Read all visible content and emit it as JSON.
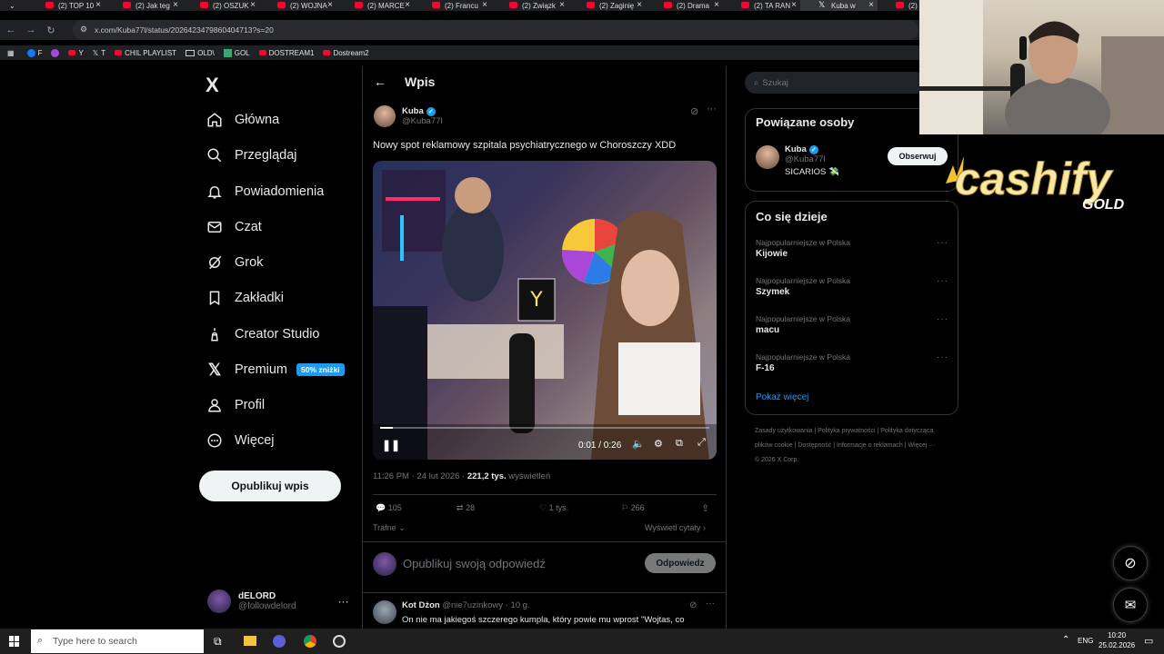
{
  "browser": {
    "tabs": [
      {
        "label": "(2) TOP 10"
      },
      {
        "label": "(2) Jak teg"
      },
      {
        "label": "(2) OSZUK"
      },
      {
        "label": "(2) WOJNA"
      },
      {
        "label": "(2) MARCE"
      },
      {
        "label": "(2) Francu"
      },
      {
        "label": "(2) Związk"
      },
      {
        "label": "(2) Zaginię"
      },
      {
        "label": "(2) Drama"
      },
      {
        "label": "(2) TA RAN"
      },
      {
        "label": "Kuba w"
      },
      {
        "label": "(2) Dl"
      }
    ],
    "url": "x.com/Kuba77l/status/2026423479860404713?s=20",
    "bookmarks": [
      "F",
      "Y",
      "T",
      "CHIL PLAYLIST",
      "OLD\\",
      "GOL",
      "DOSTREAM1",
      "Dostream2"
    ]
  },
  "sidebar": {
    "logo": "X",
    "items": [
      {
        "label": "Główna",
        "icon": "home-icon"
      },
      {
        "label": "Przeglądaj",
        "icon": "search-icon"
      },
      {
        "label": "Powiadomienia",
        "icon": "bell-icon"
      },
      {
        "label": "Czat",
        "icon": "mail-icon"
      },
      {
        "label": "Grok",
        "icon": "grok-icon"
      },
      {
        "label": "Zakładki",
        "icon": "bookmark-icon"
      },
      {
        "label": "Creator Studio",
        "icon": "creator-icon"
      },
      {
        "label": "Premium",
        "icon": "x-icon"
      },
      {
        "label": "Profil",
        "icon": "person-icon"
      },
      {
        "label": "Więcej",
        "icon": "more-circle-icon"
      }
    ],
    "premium_badge": "50% zniżki",
    "post_button": "Opublikuj wpis",
    "account": {
      "name": "dELORD",
      "handle": "@followdelord"
    }
  },
  "post": {
    "header": "Wpis",
    "author": "Kuba",
    "handle": "@Kuba77l",
    "text": "Nowy spot reklamowy szpitala psychiatrycznego w Choroszczy XDD",
    "video": {
      "time": "0:01 / 0:26",
      "progress": 0.04
    },
    "meta_time": "11:26 PM · 24 lut 2026 · ",
    "views_count": "221,2 tys.",
    "views_label": " wyświetleń",
    "stats": {
      "replies": "105",
      "reposts": "28",
      "likes": "1 tys.",
      "bookmarks": "266"
    },
    "sort_label": "Trafne",
    "quotes_label": "Wyświetl cytaty",
    "reply_placeholder": "Opublikuj swoją odpowiedź",
    "reply_button": "Odpowiedz",
    "reply": {
      "author": "Kot Dżon",
      "handle": "@nie7uzinkowy · 10 g.",
      "text": "On nie ma jakiegoś szczerego kumpla, który powie mu wprost \"Wojtas, co"
    }
  },
  "right": {
    "search_placeholder": "Szukaj",
    "related_title": "Powiązane osoby",
    "related": {
      "name": "Kuba",
      "handle": "@Kuba77l",
      "bio": "SICARIOS 💸",
      "follow": "Obserwuj"
    },
    "trends_title": "Co się dzieje",
    "trends": [
      {
        "context": "Najpopularniejsze w Polska",
        "name": "Kijowie"
      },
      {
        "context": "Najpopularniejsze w Polska",
        "name": "Szymek"
      },
      {
        "context": "Najpopularniejsze w Polska",
        "name": "macu"
      },
      {
        "context": "Najpopularniejsze w Polska",
        "name": "F-16"
      }
    ],
    "show_more": "Pokaż więcej",
    "footer": "Zasady użytkowania  |  Polityka prywatności  |  Polityka dotycząca plików cookie  |  Dostępność  |  Informacje o reklamach  |  Więcej ···  © 2026 X Corp."
  },
  "overlay": {
    "brand": "cashify",
    "brand_sub": "GOLD"
  },
  "taskbar": {
    "search_placeholder": "Type here to search",
    "lang": "ENG",
    "time": "10:20",
    "date": "25.02.2026"
  },
  "colors": {
    "accent": "#1d9bf0",
    "bg": "#000000",
    "muted": "#71767b"
  }
}
